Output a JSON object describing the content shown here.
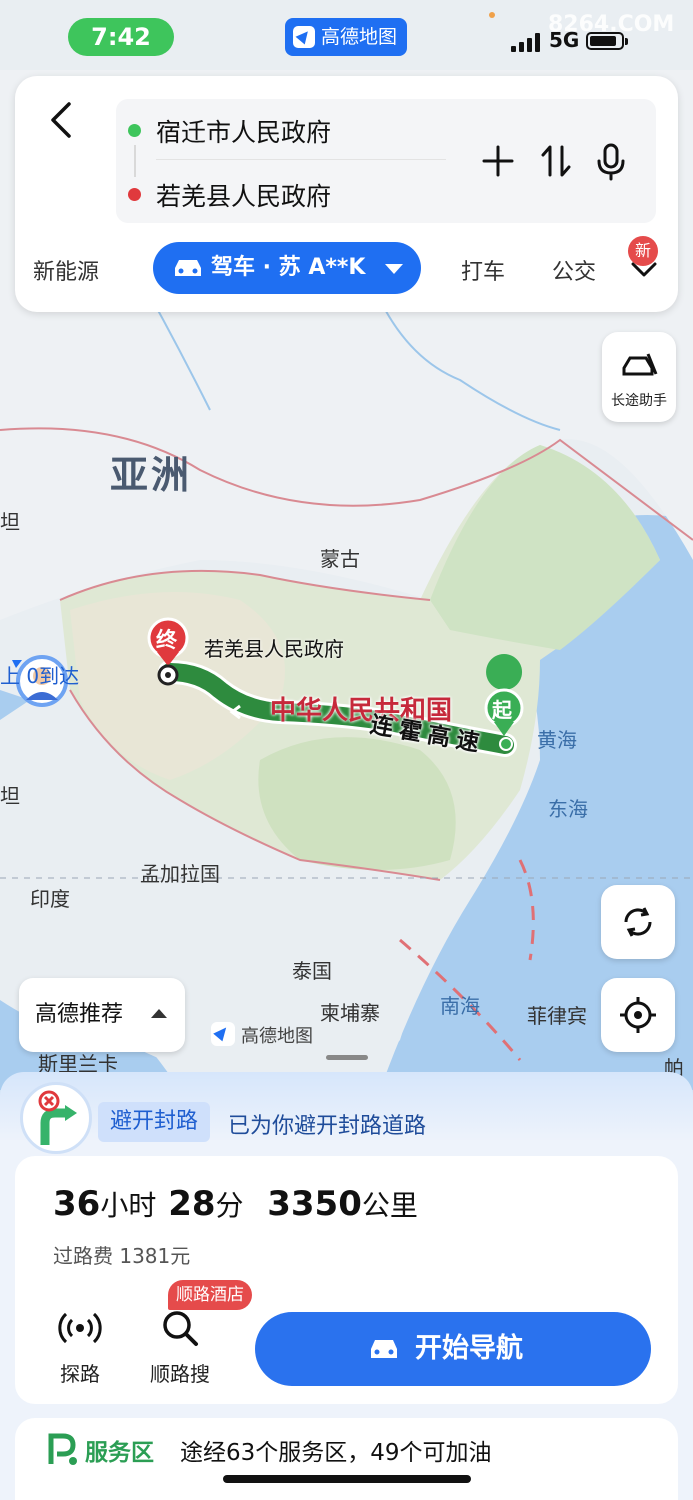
{
  "status_bar": {
    "time": "7:42",
    "app_badge": "高德地图",
    "network": "5G",
    "watermark": "8264.COM"
  },
  "route_input": {
    "origin": "宿迁市人民政府",
    "destination": "若羌县人民政府"
  },
  "travel_modes": {
    "items": [
      "新能源",
      "打车",
      "公交"
    ],
    "active": "驾车 · 苏 A**K",
    "new_badge": "新"
  },
  "map": {
    "assistant_label": "长途助手",
    "labels": {
      "continent": "亚洲",
      "mongolia": "蒙古",
      "china": "中华人民共和国",
      "yellow_sea": "黄海",
      "east_china_sea": "东海",
      "bangladesh": "孟加拉国",
      "india": "印度",
      "thailand": "泰国",
      "cambodia": "柬埔寨",
      "south_china_sea": "南海",
      "philippines": "菲律宾",
      "sri_lanka": "斯里兰卡",
      "left_edge": "坦",
      "right_edge": "帕",
      "bottom_left_edge": "坦"
    },
    "destination_label": "若羌县人民政府",
    "start_marker": "起",
    "end_marker": "终",
    "road_name": "连霍高速",
    "arrival_hint": "上  0到达",
    "recommend_label": "高德推荐",
    "logo_text": "高德地图"
  },
  "colors": {
    "accent": "#1f6ff2",
    "route": "#2e8b3e",
    "start": "#3ec55c",
    "end": "#e0393d"
  },
  "icons": [
    "back-icon",
    "plus-icon",
    "swap-icon",
    "mic-icon",
    "car-icon",
    "chevron-down-icon",
    "long-trip-icon",
    "refresh-icon",
    "locate-icon",
    "road-closure-icon",
    "probe-icon",
    "search-icon",
    "parking-icon"
  ],
  "bottom_sheet": {
    "avoid_tag": "避开封路",
    "avoid_text": "已为你避开封路道路",
    "duration_hours": "36",
    "hours_unit": "小时",
    "duration_minutes": "28",
    "minutes_unit": "分",
    "distance": "3350",
    "distance_unit": "公里",
    "toll": "过路费 1381元",
    "actions": [
      {
        "label": "探路"
      },
      {
        "label": "顺路搜"
      }
    ],
    "hotel_tag": "顺路酒店",
    "start_button": "开始导航",
    "service_label": "服务区",
    "service_text": "途经63个服务区，49个可加油"
  }
}
